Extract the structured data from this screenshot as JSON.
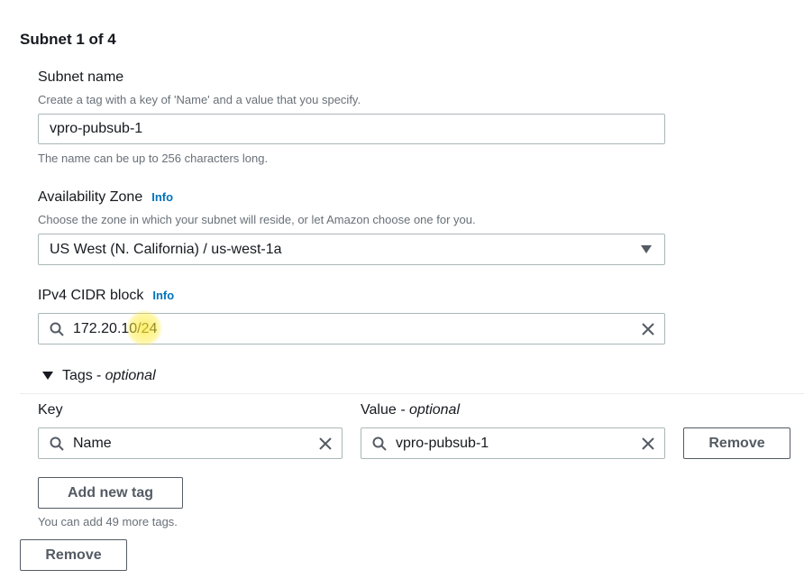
{
  "subnet": {
    "title": "Subnet 1 of 4",
    "name": {
      "label": "Subnet name",
      "description": "Create a tag with a key of 'Name' and a value that you specify.",
      "value": "vpro-pubsub-1",
      "hint": "The name can be up to 256 characters long."
    },
    "availability_zone": {
      "label": "Availability Zone",
      "info": "Info",
      "description": "Choose the zone in which your subnet will reside, or let Amazon choose one for you.",
      "selected": "US West (N. California) / us-west-1a"
    },
    "ipv4_cidr": {
      "label": "IPv4 CIDR block",
      "info": "Info",
      "value": "172.20.10/24"
    },
    "tags": {
      "toggle_label": "Tags",
      "toggle_optional": "- optional",
      "key_header": "Key",
      "value_header": "Value",
      "value_optional": "- optional",
      "rows": [
        {
          "key": "Name",
          "value": "vpro-pubsub-1",
          "remove_label": "Remove"
        }
      ],
      "add_label": "Add new tag",
      "limit_text": "You can add 49 more tags."
    },
    "remove_label": "Remove"
  }
}
